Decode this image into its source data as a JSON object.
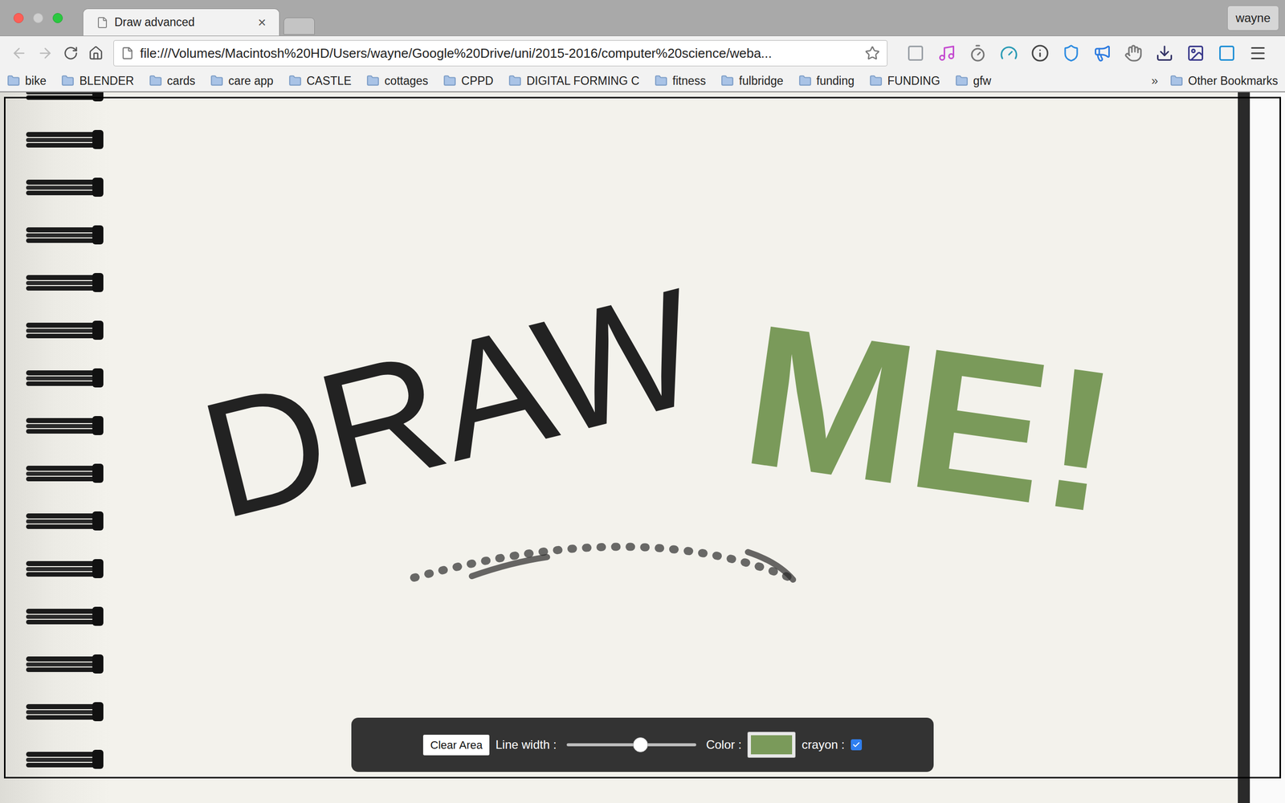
{
  "window": {
    "tabs": [
      {
        "title": "Draw advanced",
        "selected": true,
        "close": "×"
      },
      {
        "title": "",
        "selected": false
      }
    ],
    "user": "wayne",
    "address": "file:///Volumes/Macintosh%20HD/Users/wayne/Google%20Drive/uni/2015-2016/computer%20science/weba...",
    "bookmarks": [
      "bike",
      "BLENDER",
      "cards",
      "care app",
      "CASTLE",
      "cottages",
      "CPPD",
      "DIGITAL FORMING C",
      "fitness",
      "fulbridge",
      "funding",
      "FUNDING",
      "gfw"
    ],
    "bookmarks_overflow": "»",
    "other_bookmarks": "Other Bookmarks"
  },
  "canvas": {
    "drawing": [
      {
        "text": "DRAW",
        "color": "#222222"
      },
      {
        "text": "ME!",
        "color": "#7a9a5a"
      }
    ]
  },
  "controls": {
    "clear_button": "Clear Area",
    "line_width_label": "Line width :",
    "line_width_level": 0.57,
    "color_label": "Color :",
    "color": "#7a9a5a",
    "crayon_label": "crayon :",
    "crayon_checked": true
  }
}
